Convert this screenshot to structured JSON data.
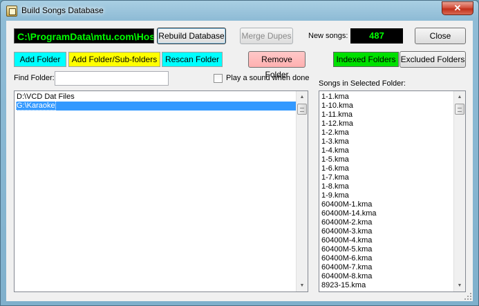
{
  "window": {
    "title": "Build Songs Database",
    "close_glyph": "✕",
    "icon": "database-app-icon"
  },
  "toolbar": {
    "path_display": "C:\\ProgramData\\mtu.com\\Hos",
    "rebuild_label": "Rebuild Database",
    "merge_label": "Merge Dupes",
    "new_songs_label": "New songs:",
    "new_songs_count": "487",
    "close_label": "Close"
  },
  "folder_buttons": {
    "add_folder": "Add Folder",
    "add_folder_sub": "Add Folder/Sub-folders",
    "rescan_folder": "Rescan Folder",
    "remove_folder": "Remove Folder",
    "indexed_folders": "Indexed Folders",
    "excluded_folders": "Excluded Folders"
  },
  "colors": {
    "add_folder": "#00ffff",
    "add_folder_sub": "#ffff00",
    "rescan_folder": "#00ffff",
    "remove_folder": "#ffb6b6",
    "indexed_folders": "#00e000",
    "display_text": "#00ff00"
  },
  "find": {
    "label": "Find Folder:",
    "value": "",
    "play_sound_label": "Play a sound when done"
  },
  "folders": {
    "items": [
      "D:\\VCD Dat Files",
      "G:\\Karaoke"
    ],
    "selected_index": 1
  },
  "songs": {
    "label": "Songs in Selected Folder:",
    "items": [
      "1-1.kma",
      "1-10.kma",
      "1-11.kma",
      "1-12.kma",
      "1-2.kma",
      "1-3.kma",
      "1-4.kma",
      "1-5.kma",
      "1-6.kma",
      "1-7.kma",
      "1-8.kma",
      "1-9.kma",
      "60400M-1.kma",
      "60400M-14.kma",
      "60400M-2.kma",
      "60400M-3.kma",
      "60400M-4.kma",
      "60400M-5.kma",
      "60400M-6.kma",
      "60400M-7.kma",
      "60400M-8.kma",
      "8923-15.kma"
    ]
  }
}
